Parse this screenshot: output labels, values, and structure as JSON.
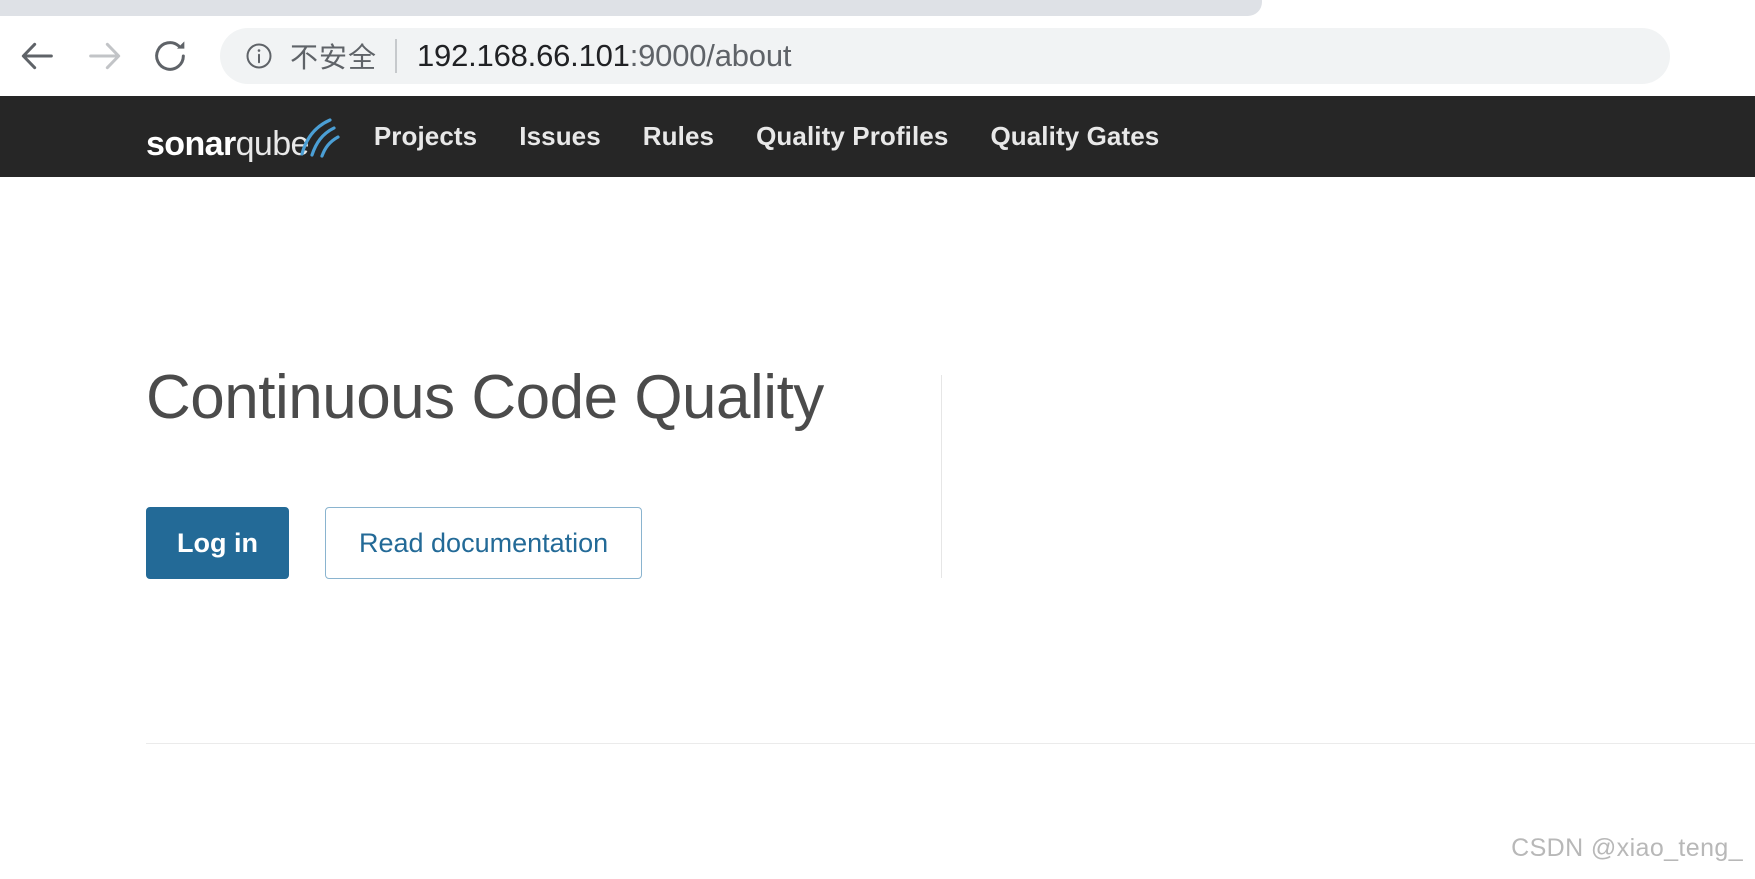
{
  "browser": {
    "back_icon": "back-arrow-icon",
    "forward_icon": "forward-arrow-icon",
    "reload_icon": "reload-icon",
    "omnibox": {
      "info_icon": "info-circle-icon",
      "security_label": "不安全",
      "url_host": "192.168.66.101",
      "url_rest": ":9000/about",
      "full_url": "192.168.66.101:9000/about"
    }
  },
  "navbar": {
    "logo": {
      "sonar": "sonar",
      "qube": "qube",
      "wave_icon": "sonar-wave-icon",
      "wave_color": "#4b9fd5"
    },
    "background_color": "#262626",
    "items": [
      {
        "label": "Projects"
      },
      {
        "label": "Issues"
      },
      {
        "label": "Rules"
      },
      {
        "label": "Quality Profiles"
      },
      {
        "label": "Quality Gates"
      }
    ]
  },
  "hero": {
    "title": "Continuous Code Quality",
    "login_label": "Log in",
    "docs_label": "Read documentation",
    "accent_color": "#236a97"
  },
  "watermark": {
    "text": "CSDN @xiao_teng_"
  }
}
